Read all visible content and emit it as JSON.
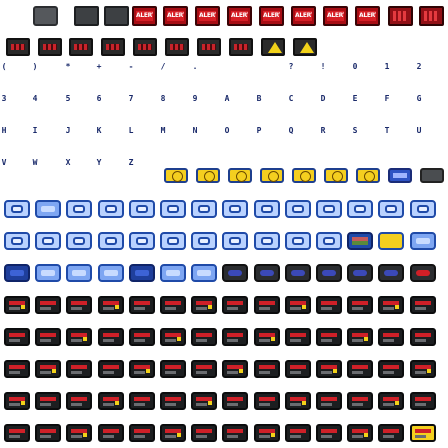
{
  "sheet": {
    "row1_labels": [
      "ALERT",
      "ALERT",
      "ALERT",
      "ALERT",
      "ALERT",
      "ALERT",
      "ALERT",
      "ALERT"
    ],
    "glyphs_row1": [
      "(",
      ")",
      "*",
      "+",
      "-",
      "/",
      ".",
      "?",
      "!",
      "0",
      "1",
      "2"
    ],
    "glyphs_row2": [
      "3",
      "4",
      "5",
      "6",
      "7",
      "8",
      "9",
      "A",
      "B",
      "C",
      "D",
      "E",
      "F",
      "G"
    ],
    "glyphs_row3": [
      "H",
      "I",
      "J",
      "K",
      "L",
      "M",
      "N",
      "O",
      "P",
      "Q",
      "R",
      "S",
      "T",
      "U"
    ],
    "glyphs_row4": [
      "V",
      "W",
      "X",
      "Y",
      "Z"
    ]
  },
  "colors": {
    "accent_red": "#d61e25",
    "accent_blue": "#1f4aa8",
    "accent_yellow": "#f4cf1f",
    "dark": "#1c1e20"
  },
  "icons": [
    "keyboard-icon",
    "alert-icon",
    "warning-icon",
    "smiley-icon",
    "screen-icon"
  ]
}
